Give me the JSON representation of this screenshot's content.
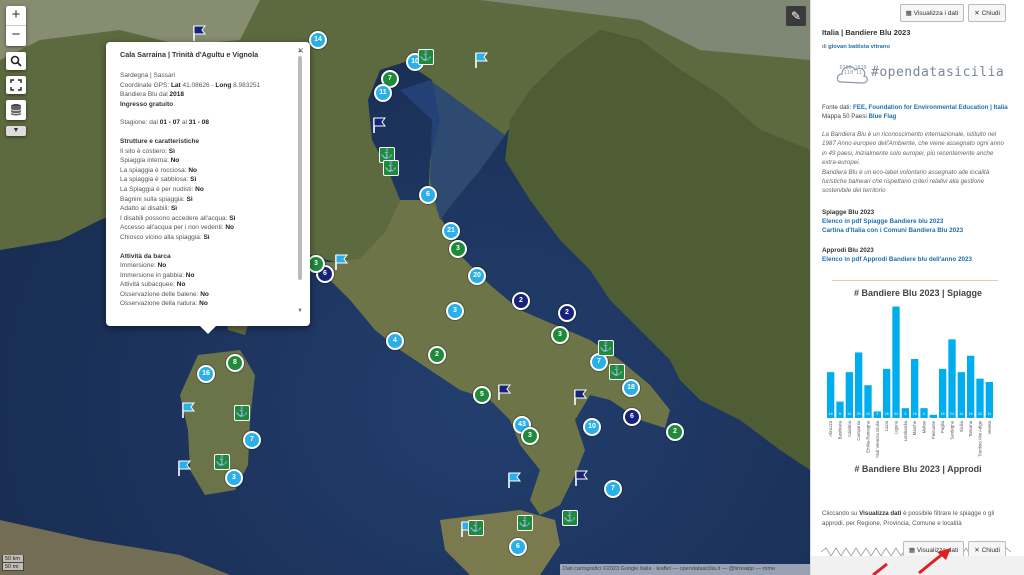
{
  "map": {
    "zoom_in": "+",
    "zoom_out": "−",
    "search_icon": "search-icon",
    "fullscreen_icon": "fullscreen-icon",
    "layers_icon": "layers-icon",
    "edit_icon": "pencil-icon",
    "clusters": [
      {
        "label": "14",
        "color": "light"
      },
      {
        "label": "10",
        "color": "light"
      },
      {
        "label": "7",
        "color": "green"
      },
      {
        "label": "11",
        "color": "light"
      },
      {
        "label": "6",
        "color": "light"
      },
      {
        "label": "21",
        "color": "light"
      },
      {
        "label": "3",
        "color": "green"
      },
      {
        "label": "20",
        "color": "light"
      },
      {
        "label": "3",
        "color": "light"
      },
      {
        "label": "2",
        "color": "navy"
      },
      {
        "label": "2",
        "color": "navy"
      },
      {
        "label": "3",
        "color": "green"
      },
      {
        "label": "4",
        "color": "light"
      },
      {
        "label": "2",
        "color": "green"
      },
      {
        "label": "6",
        "color": "navy"
      },
      {
        "label": "3",
        "color": "green"
      },
      {
        "label": "16",
        "color": "light"
      },
      {
        "label": "8",
        "color": "green"
      },
      {
        "label": "7",
        "color": "light"
      },
      {
        "label": "5",
        "color": "green"
      },
      {
        "label": "7",
        "color": "light"
      },
      {
        "label": "18",
        "color": "light"
      },
      {
        "label": "6",
        "color": "navy"
      },
      {
        "label": "2",
        "color": "green"
      },
      {
        "label": "43",
        "color": "light"
      },
      {
        "label": "3",
        "color": "green"
      },
      {
        "label": "10",
        "color": "light"
      },
      {
        "label": "7",
        "color": "light"
      },
      {
        "label": "3",
        "color": "light"
      },
      {
        "label": "6",
        "color": "light"
      }
    ],
    "attribution": "Dati cartografici ©2023 Google Italia · leaflet — opendatasicilia.it — @tirreaipp — mme",
    "scale": [
      "50 km",
      "50 mi"
    ]
  },
  "popup": {
    "title": "Cala Sarraina | Trinità d'Agultu e Vignola",
    "location": "Sardegna | Sassari",
    "gps_prefix": "Coordinate GPS:",
    "lat_label": "Lat",
    "lat": "41.08626",
    "long_label": "Long",
    "long": "8.983251",
    "flag_prefix": "Bandiera Blu dal",
    "flag_year": "2018",
    "entry": "Ingresso gratuito",
    "season_prefix": "Stagione: dal",
    "season_from": "01 - 07",
    "season_mid": "al",
    "season_to": "31 - 08",
    "structures_title": "Strutture e caratteristiche",
    "structures": [
      {
        "label": "Il sito è costiero:",
        "value": "Sì"
      },
      {
        "label": "Spiaggia interna:",
        "value": "No"
      },
      {
        "label": "La spiaggia è rocciosa:",
        "value": "No"
      },
      {
        "label": "La spiaggia è sabbiosa:",
        "value": "Sì"
      },
      {
        "label": "La Spiaggia è per nudisti:",
        "value": "No"
      },
      {
        "label": "Bagnini sulla spiaggia:",
        "value": "Sì"
      },
      {
        "label": "Adatto ai disabili:",
        "value": "Sì"
      },
      {
        "label": "I disabili possono accedere all'acqua:",
        "value": "Sì"
      },
      {
        "label": "Accesso all'acqua per i non vedenti:",
        "value": "No"
      },
      {
        "label": "Chiosco vicino alla spiaggia:",
        "value": "Sì"
      }
    ],
    "boat_title": "Attività da barca",
    "boat": [
      {
        "label": "Immersione:",
        "value": "No"
      },
      {
        "label": "Immersione in gabbia:",
        "value": "No"
      },
      {
        "label": "Attività subacquee:",
        "value": "No"
      },
      {
        "label": "Osservazione delle balene:",
        "value": "No"
      },
      {
        "label": "Osservazione della natura:",
        "value": "No"
      }
    ],
    "close": "×"
  },
  "panel": {
    "btn_view": "Visualizza i dati",
    "btn_close": "Chiudi",
    "title": "Italia | Bandiere Blu 2023",
    "author_prefix": "di",
    "author": "giovan battista vitrano",
    "logo_text": "#opendatasicilia",
    "logo_bits": "0110 1010 110 11",
    "source_prefix": "Fonte dati:",
    "source_link": "FEE, Foundation for Environmental Education | Italia",
    "map_prefix": "Mappa 50 Paesi",
    "map_link": "Blue Flag",
    "description_1": "La Bandiera Blu è un riconoscimento internazionale, istituito nel 1987 Anno europeo dell'Ambiente, che viene assegnato ogni anno in 49 paesi, inizialmente solo europei, più recentemente anche extra-europei.",
    "description_2": "Bandiera Blu è un eco-label volontario assegnato alle località turistiche balneari che rispettano criteri relativi alla gestione sostenibile del territorio",
    "beaches_title": "Spiagge Blu 2023",
    "beaches_link_1": "Elenco in pdf Spiagge Bandiere blu 2023",
    "beaches_link_2": "Cartina d'Italia con i Comuni Bandiera Blu 2023",
    "ports_title": "Approdi Blu 2023",
    "ports_link": "Elenco in pdf Approdi Bandiere blu dell'anno 2023",
    "chart2_title": "# Bandiere Blu 2023 | Approdi",
    "footer_1": "Cliccando su",
    "footer_bold": "Visualizza dati",
    "footer_2": "è possibile filtrare le spiagge o gli approdi, per Regione, Provincia, Comune e località",
    "btn_view_bottom": "Visualizza dati",
    "btn_close_bottom": "Chiudi"
  },
  "colors": {
    "bar": "#00aeef",
    "light_cluster": "#29b0ea",
    "green_cluster": "#1f8b3a",
    "navy_cluster": "#16237a"
  },
  "chart_data": {
    "type": "bar",
    "title": "# Bandiere Blu 2023 | Spiagge",
    "categories": [
      "Abruzzo",
      "Basilicata",
      "Calabria",
      "Campania",
      "Emilia-Romagna",
      "Friuli Venezia Giulia",
      "Lazio",
      "Liguria",
      "Lombardia",
      "Marche",
      "Molise",
      "Piemonte",
      "Puglia",
      "Sardegna",
      "Sicilia",
      "Toscana",
      "Trentino Alto Adige",
      "Veneto"
    ],
    "values": [
      14,
      5,
      14,
      20,
      10,
      2,
      15,
      34,
      3,
      18,
      3,
      1,
      15,
      24,
      14,
      19,
      12,
      11
    ],
    "ylim": [
      0,
      36
    ]
  }
}
